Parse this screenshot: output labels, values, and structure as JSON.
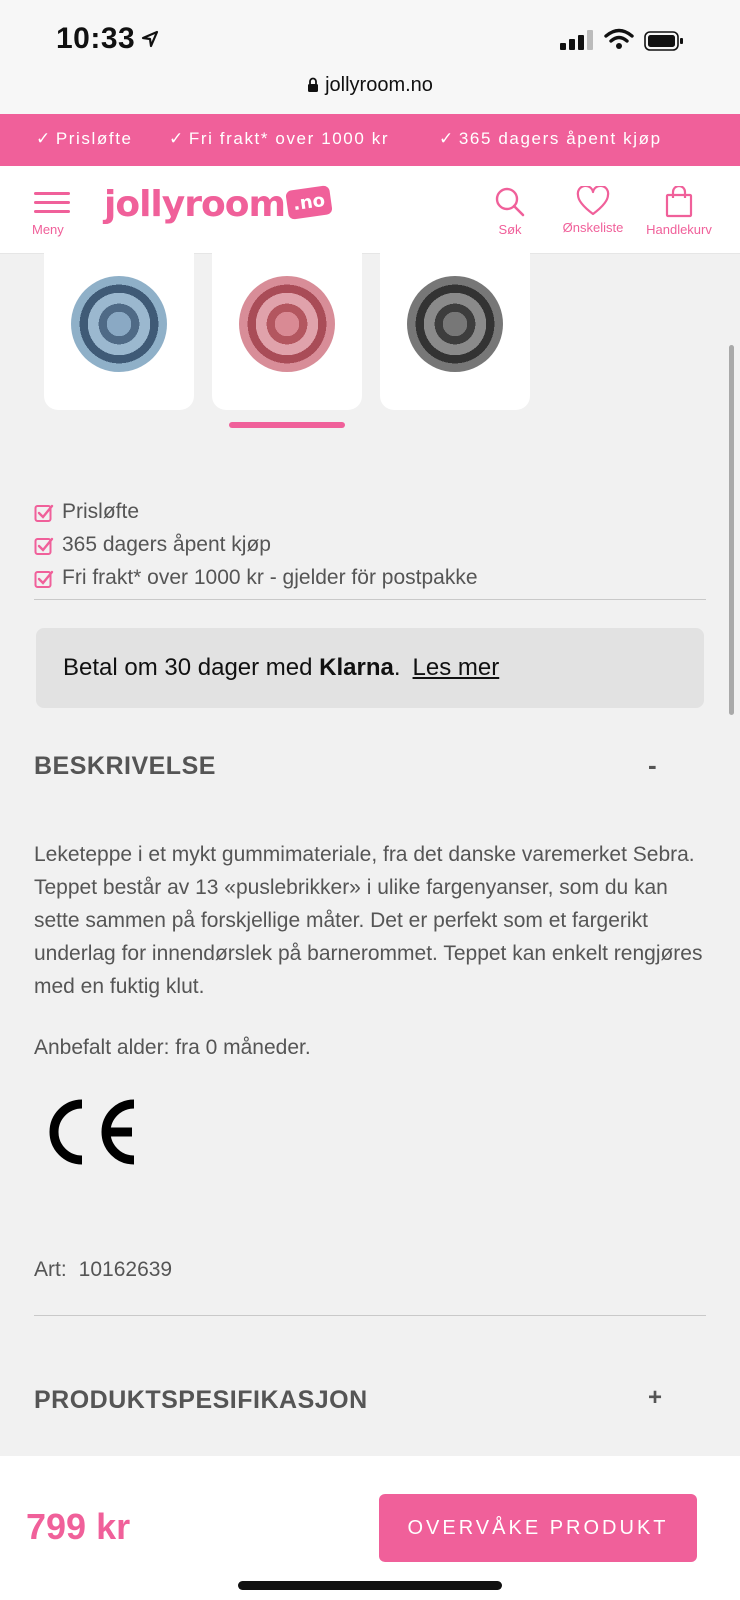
{
  "status": {
    "time": "10:33"
  },
  "browser": {
    "url": "jollyroom.no"
  },
  "promo": [
    {
      "label": "Prisløfte"
    },
    {
      "label": "Fri frakt* over 1000 kr"
    },
    {
      "label": "365 dagers åpent kjøp"
    }
  ],
  "header": {
    "menu_label": "Meny",
    "logo_text": "jollyroom",
    "logo_suffix": ".no",
    "search_label": "Søk",
    "wishlist_label": "Ønskeliste",
    "cart_label": "Handlekurv"
  },
  "thumbnails": [
    {
      "color": "blue",
      "active": false
    },
    {
      "color": "pink",
      "active": true
    },
    {
      "color": "grey",
      "active": false
    }
  ],
  "usps": [
    "Prisløfte",
    "365 dagers åpent kjøp",
    "Fri frakt* over 1000 kr - gjelder för postpakke"
  ],
  "klarna": {
    "text_before": "Betal om 30 dager med ",
    "brand": "Klarna",
    "text_after": ".",
    "link": "Les mer"
  },
  "description": {
    "title": "BESKRIVELSE",
    "toggle": "-",
    "body": "Leketeppe i et mykt gummimateriale, fra det danske varemerket Sebra. Teppet består av 13 «puslebrikker» i ulike fargenyanser, som du kan sette sammen på forskjellige måter. Det er perfekt som et fargerikt underlag for innendørslek på barnerommet. Teppet kan enkelt rengjøres med en fuktig klut.",
    "age": "Anbefalt alder: fra 0 måneder.",
    "mark": "CE",
    "art_label": "Art:",
    "art_number": "10162639"
  },
  "specification": {
    "title": "PRODUKTSPESIFIKASJON",
    "toggle": "+"
  },
  "footer": {
    "price": "799 kr",
    "button": "OVERVÅKE PRODUKT"
  },
  "colors": {
    "brand": "#f0609a",
    "background": "#f1f1f1"
  }
}
